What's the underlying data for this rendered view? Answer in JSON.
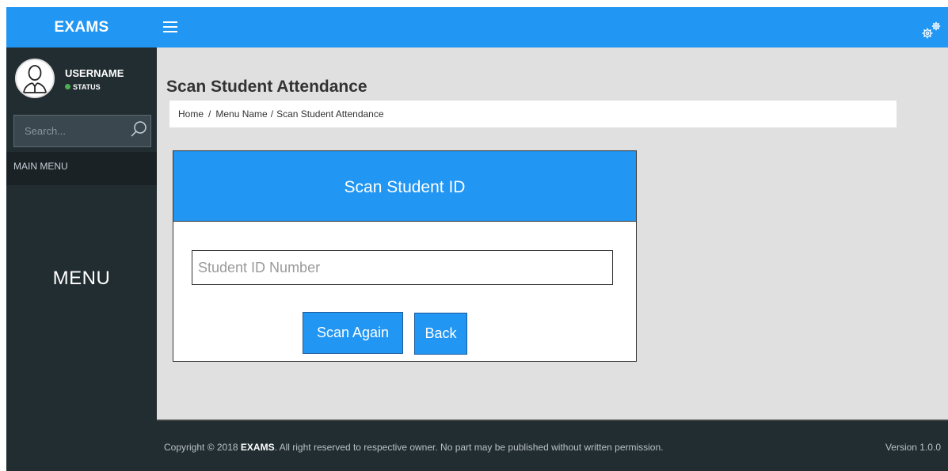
{
  "header": {
    "brand": "EXAMS",
    "menu_icon": "hamburger-icon",
    "settings_icon": "gears-icon",
    "accent_color": "#2196f3"
  },
  "sidebar": {
    "username": "USERNAME",
    "status": "STATUS",
    "status_color": "#4caf50",
    "search_placeholder": "Search...",
    "main_menu_label": "MAIN MENU",
    "menu_label": "MENU"
  },
  "page": {
    "title": "Scan Student Attendance",
    "breadcrumb": [
      "Home",
      "Menu Name",
      "Scan Student Attendance"
    ]
  },
  "card": {
    "title": "Scan Student ID",
    "input_placeholder": "Student ID Number",
    "input_value": "",
    "scan_again_label": "Scan Again",
    "back_label": "Back"
  },
  "footer": {
    "copyright_prefix": "Copyright © 2018 ",
    "copyright_brand": "EXAMS",
    "copyright_suffix": ". All right reserved to respective owner. No part may be published without written permission.",
    "version": "Version 1.0.0"
  }
}
